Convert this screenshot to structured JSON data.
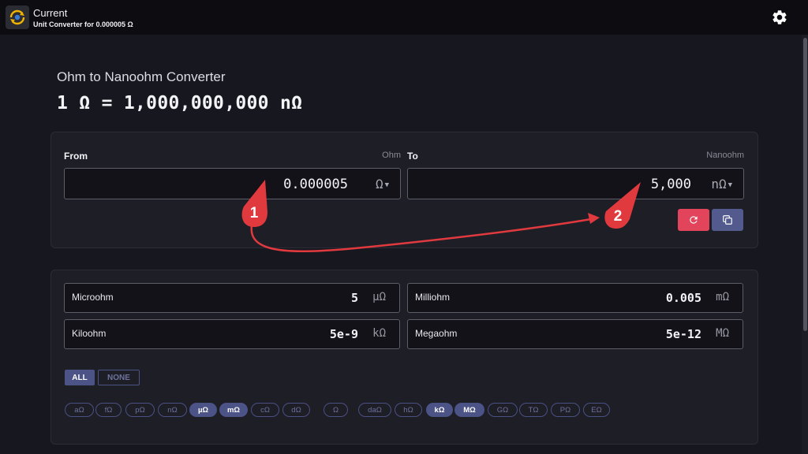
{
  "header": {
    "title": "Current",
    "subtitle": "Unit Converter for 0.000005 Ω"
  },
  "converter": {
    "heading": "Ohm to Nanoohm Converter",
    "equation": "1 Ω = 1,000,000,000 nΩ",
    "from": {
      "label": "From",
      "unit_name": "Ohm",
      "value": "0.000005",
      "unit_symbol": "Ω"
    },
    "to": {
      "label": "To",
      "unit_name": "Nanoohm",
      "value": "5,000",
      "unit_symbol": "nΩ"
    }
  },
  "results": [
    {
      "name": "Microohm",
      "value": "5",
      "unit": "µΩ"
    },
    {
      "name": "Milliohm",
      "value": "0.005",
      "unit": "mΩ"
    },
    {
      "name": "Kiloohm",
      "value": "5e-9",
      "unit": "kΩ"
    },
    {
      "name": "Megaohm",
      "value": "5e-12",
      "unit": "MΩ"
    }
  ],
  "filters": {
    "all_label": "ALL",
    "none_label": "NONE"
  },
  "chips": [
    {
      "label": "aΩ",
      "selected": false
    },
    {
      "label": "fΩ",
      "selected": false
    },
    {
      "label": "pΩ",
      "selected": false
    },
    {
      "label": "nΩ",
      "selected": false
    },
    {
      "label": "µΩ",
      "selected": true
    },
    {
      "label": "mΩ",
      "selected": true
    },
    {
      "label": "cΩ",
      "selected": false
    },
    {
      "label": "dΩ",
      "selected": false
    },
    {
      "label": "Ω",
      "selected": false
    },
    {
      "label": "daΩ",
      "selected": false
    },
    {
      "label": "hΩ",
      "selected": false
    },
    {
      "label": "kΩ",
      "selected": true
    },
    {
      "label": "MΩ",
      "selected": true
    },
    {
      "label": "GΩ",
      "selected": false
    },
    {
      "label": "TΩ",
      "selected": false
    },
    {
      "label": "PΩ",
      "selected": false
    },
    {
      "label": "EΩ",
      "selected": false
    }
  ],
  "annotations": {
    "marker_1": "1",
    "marker_2": "2",
    "color": "#e0393e"
  },
  "colors": {
    "accent": "#4c5386",
    "reset_button": "#e2445c",
    "copy_button": "#535a8e",
    "background": "#17171f"
  }
}
